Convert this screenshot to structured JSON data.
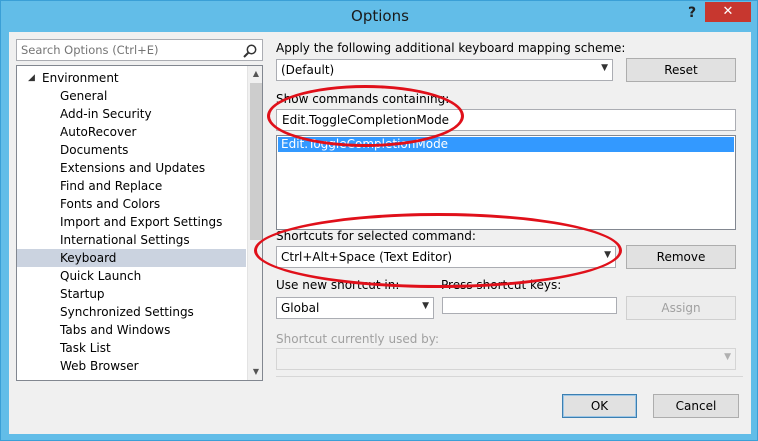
{
  "window": {
    "title": "Options",
    "help_label": "?",
    "close_label": "✕"
  },
  "search": {
    "placeholder": "Search Options (Ctrl+E)"
  },
  "tree": {
    "root_label": "Environment",
    "items": [
      {
        "label": "General"
      },
      {
        "label": "Add-in Security"
      },
      {
        "label": "AutoRecover"
      },
      {
        "label": "Documents"
      },
      {
        "label": "Extensions and Updates"
      },
      {
        "label": "Find and Replace"
      },
      {
        "label": "Fonts and Colors"
      },
      {
        "label": "Import and Export Settings"
      },
      {
        "label": "International Settings"
      },
      {
        "label": "Keyboard",
        "selected": true
      },
      {
        "label": "Quick Launch"
      },
      {
        "label": "Startup"
      },
      {
        "label": "Synchronized Settings"
      },
      {
        "label": "Tabs and Windows"
      },
      {
        "label": "Task List"
      },
      {
        "label": "Web Browser"
      }
    ]
  },
  "keyboard": {
    "scheme_label": "Apply the following additional keyboard mapping scheme:",
    "scheme_value": "(Default)",
    "reset_label": "Reset",
    "show_commands_label": "Show commands containing:",
    "command_filter_value": "Edit.ToggleCompletionMode",
    "command_list": [
      "Edit.ToggleCompletionMode"
    ],
    "shortcuts_label": "Shortcuts for selected command:",
    "shortcut_value": "Ctrl+Alt+Space (Text Editor)",
    "remove_label": "Remove",
    "use_new_shortcut_label": "Use new shortcut in:",
    "use_in_value": "Global",
    "press_keys_label": "Press shortcut keys:",
    "press_keys_value": "",
    "assign_label": "Assign",
    "currently_used_label": "Shortcut currently used by:",
    "currently_used_value": ""
  },
  "footer": {
    "ok_label": "OK",
    "cancel_label": "Cancel"
  },
  "colors": {
    "titlebar": "#62bde8",
    "close": "#c7372f",
    "selection": "#3399ff",
    "highlight_ellipse": "#e0101a",
    "tree_selected": "#cbd3e0"
  }
}
